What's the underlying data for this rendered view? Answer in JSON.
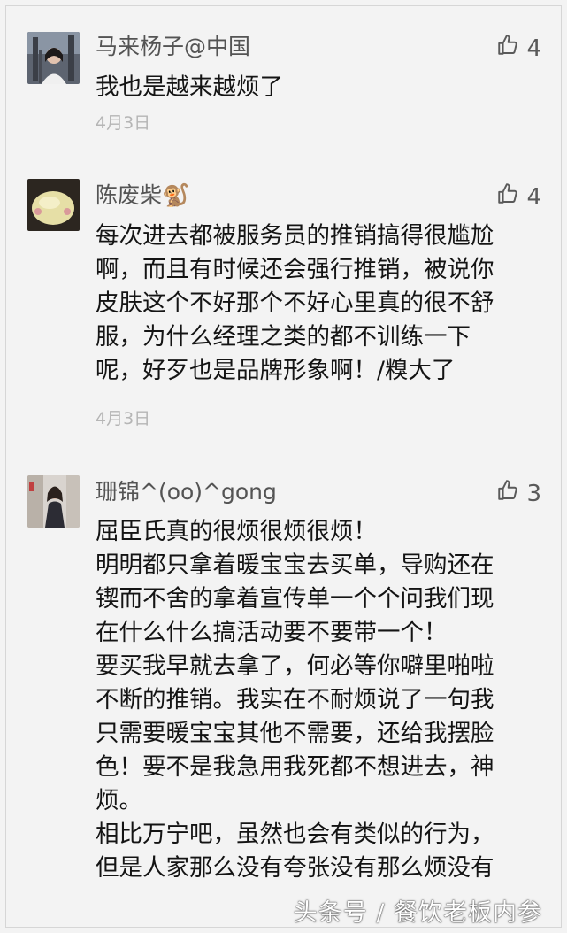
{
  "comments": [
    {
      "name": "马来杨子@中国",
      "likes": "4",
      "text": "我也是越来越烦了",
      "date": "4月3日",
      "avatar_icon": "city-portrait-avatar"
    },
    {
      "name": "陈废柴🐒",
      "likes": "4",
      "text": "每次进去都被服务员的推销搞得很尴尬\n啊，而且有时候还会强行推销，被说你\n皮肤这个不好那个不好心里真的很不舒\n服，为什么经理之类的都不训练一下\n呢，好歹也是品牌形象啊！/糗大了",
      "date": "4月3日",
      "avatar_icon": "round-dessert-avatar"
    },
    {
      "name": "珊锦^(oo)^gong",
      "likes": "3",
      "text": "屈臣氏真的很烦很烦很烦！\n明明都只拿着暖宝宝去买单，导购还在\n锲而不舍的拿着宣传单一个个问我们现\n在什么什么搞活动要不要带一个！\n要买我早就去拿了，何必等你噼里啪啦\n不断的推销。我实在不耐烦说了一句我\n只需要暖宝宝其他不需要，还给我摆脸\n色！要不是我急用我死都不想进去，神\n烦。\n相比万宁吧，虽然也会有类似的行为，\n但是人家那么没有夸张没有那么烦没有",
      "avatar_icon": "woman-portrait-avatar"
    }
  ],
  "watermark": "头条号 / 餐饮老板内参",
  "colors": {
    "background": "#f3f3f3",
    "name": "#545454",
    "text": "#141414",
    "date": "#b5b5b5",
    "like": "#5a5a5a"
  }
}
